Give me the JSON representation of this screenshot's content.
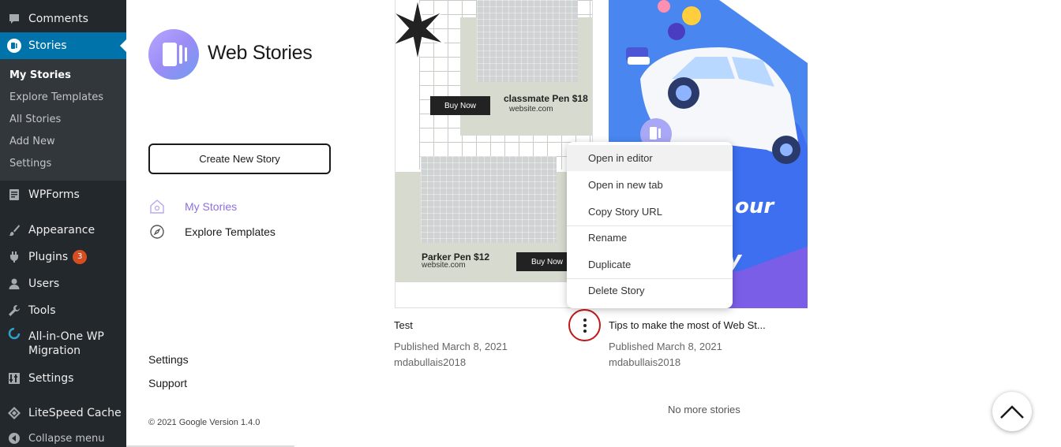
{
  "wp_sidebar": {
    "items": [
      {
        "label": "Comments",
        "icon": "comment-icon"
      },
      {
        "label": "Stories",
        "icon": "stories-icon"
      },
      {
        "label": "WPForms",
        "icon": "wpforms-icon"
      },
      {
        "label": "Appearance",
        "icon": "brush-icon"
      },
      {
        "label": "Plugins",
        "icon": "plugin-icon",
        "badge": "3"
      },
      {
        "label": "Users",
        "icon": "users-icon"
      },
      {
        "label": "Tools",
        "icon": "wrench-icon"
      },
      {
        "label": "All-in-One WP Migration",
        "label_line1": "All-in-One WP",
        "label_line2": "Migration",
        "icon": "migration-icon"
      },
      {
        "label": "Settings",
        "icon": "settings-icon"
      },
      {
        "label": "LiteSpeed Cache",
        "icon": "diamond-icon"
      },
      {
        "label": "Collapse menu",
        "icon": "collapse-icon"
      }
    ],
    "submenu": [
      "My Stories",
      "Explore Templates",
      "All Stories",
      "Add New",
      "Settings"
    ],
    "active_color": "#0073aa",
    "badge_color": "#d54e21"
  },
  "web_stories": {
    "brand": "Web Stories",
    "create_label": "Create New Story",
    "nav": [
      {
        "label": "My Stories",
        "icon": "home-icon",
        "color": "#8e6fe0"
      },
      {
        "label": "Explore Templates",
        "icon": "compass-icon",
        "color": "#1a1a1a"
      }
    ],
    "links": [
      "Settings",
      "Support"
    ],
    "footer": "© 2021 Google Version 1.4.0"
  },
  "stories": [
    {
      "title": "Test",
      "published": "Published March 8, 2021",
      "author": "mdabullais2018",
      "thumb": {
        "product1": "classmate Pen $18",
        "site1": "website.com",
        "buy1": "Buy Now",
        "product2": "Parker Pen $12",
        "site2": "website.com",
        "buy2": "Buy Now"
      }
    },
    {
      "title": "Tips to make the most of Web St...",
      "published": "Published March 8, 2021",
      "author": "mdabullais2018",
      "thumb": {
        "text1": "our",
        "text2": "y"
      }
    }
  ],
  "context_menu": {
    "items": [
      "Open in editor",
      "Open in new tab",
      "Copy Story URL",
      "Rename",
      "Duplicate",
      "Delete Story"
    ],
    "highlighted": "Open in editor"
  },
  "no_more": "No more stories",
  "icons": {
    "more": "more-vertical-icon",
    "scroll_top": "chevron-up-icon"
  }
}
